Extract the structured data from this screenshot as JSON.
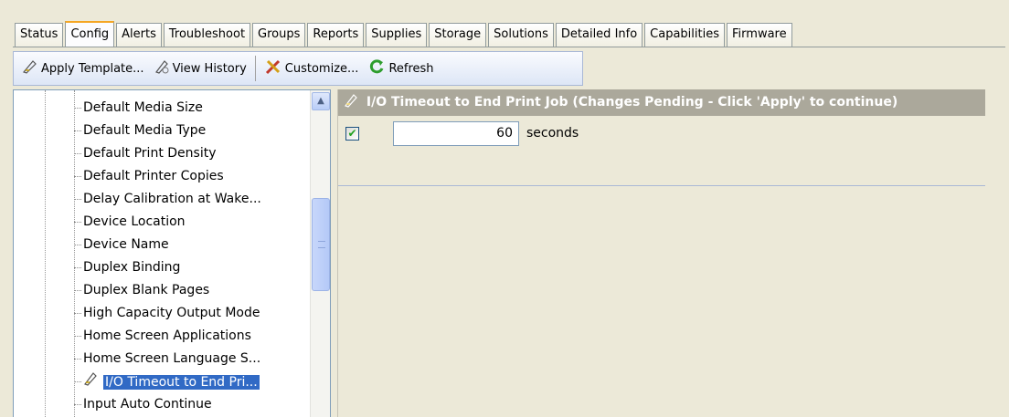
{
  "tabs": [
    {
      "label": "Status"
    },
    {
      "label": "Config"
    },
    {
      "label": "Alerts"
    },
    {
      "label": "Troubleshoot"
    },
    {
      "label": "Groups"
    },
    {
      "label": "Reports"
    },
    {
      "label": "Supplies"
    },
    {
      "label": "Storage"
    },
    {
      "label": "Solutions"
    },
    {
      "label": "Detailed Info"
    },
    {
      "label": "Capabilities"
    },
    {
      "label": "Firmware"
    }
  ],
  "active_tab": "Config",
  "toolbar": {
    "apply_template": "Apply Template...",
    "view_history": "View History",
    "customize": "Customize...",
    "refresh": "Refresh"
  },
  "tree": {
    "items": [
      "Default Media Size",
      "Default Media Type",
      "Default Print Density",
      "Default Printer Copies",
      "Delay Calibration at Wake...",
      "Device Location",
      "Device Name",
      "Duplex Binding",
      "Duplex Blank Pages",
      "High Capacity Output Mode",
      "Home Screen Applications",
      "Home Screen Language S...",
      "I/O Timeout to End Pri...",
      "Input Auto Continue"
    ],
    "selected": "I/O Timeout to End Pri..."
  },
  "setting": {
    "header": "I/O Timeout to End Print Job (Changes Pending - Click 'Apply' to continue)",
    "enabled": true,
    "check_glyph": "✔",
    "value": "60",
    "units": "seconds"
  },
  "colors": {
    "selection": "#316ac5",
    "header_bg": "#aba89b",
    "active_tab_accent": "#f5a623",
    "background": "#ece9d8"
  }
}
